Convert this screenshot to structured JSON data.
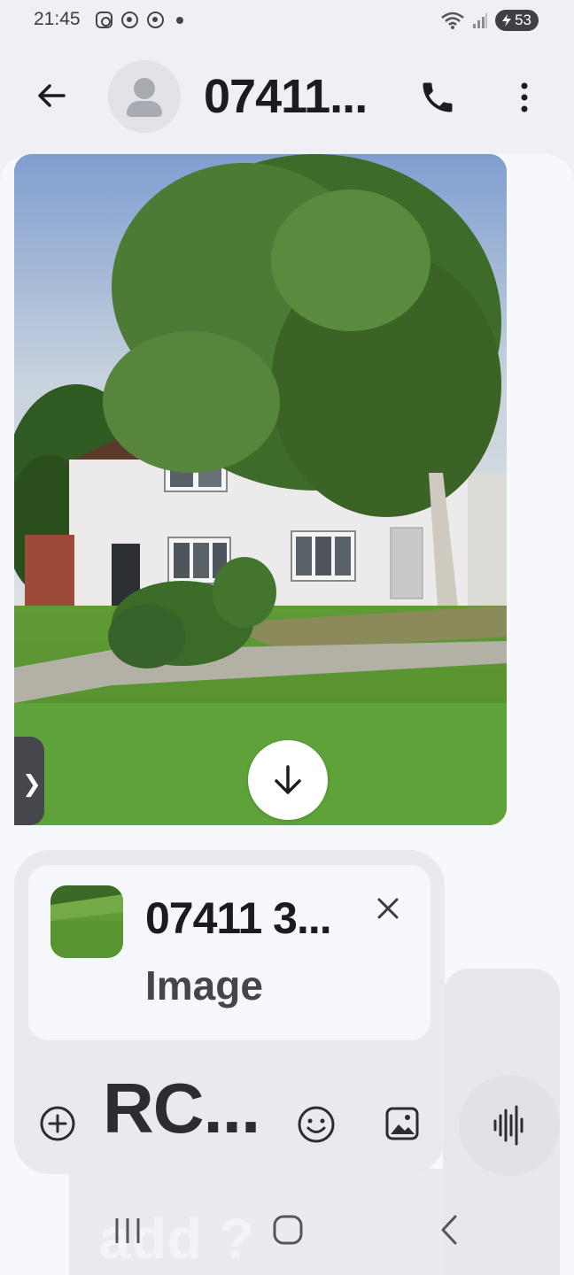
{
  "status_bar": {
    "time": "21:45",
    "battery": "53",
    "icons": [
      "instagram-icon",
      "chrome-icon",
      "chrome-icon",
      "notification-dot-icon",
      "wifi-icon",
      "signal-icon",
      "battery-icon"
    ]
  },
  "header": {
    "title": "07411...",
    "icons": [
      "back-arrow-icon",
      "person-icon",
      "phone-icon",
      "more-vert-icon"
    ]
  },
  "message": {
    "type": "image",
    "icons": [
      "download-icon",
      "chevron-right-icon"
    ],
    "side_handle": "❯"
  },
  "composer": {
    "reply": {
      "sender": "07411 3...",
      "type": "Image"
    },
    "input_text": "RC...",
    "icons": [
      "add-circle-icon",
      "emoji-icon",
      "gallery-icon",
      "voice-icon",
      "close-icon"
    ]
  },
  "background_text": "add ?",
  "nav_bar": {
    "icons": [
      "recent-apps-icon",
      "home-icon",
      "back-icon"
    ]
  },
  "colors": {
    "app_background": "#eef0f5",
    "conversation_background": "#f7f8fc",
    "composer": "#e9eaef",
    "text_primary": "#1b1c20"
  }
}
